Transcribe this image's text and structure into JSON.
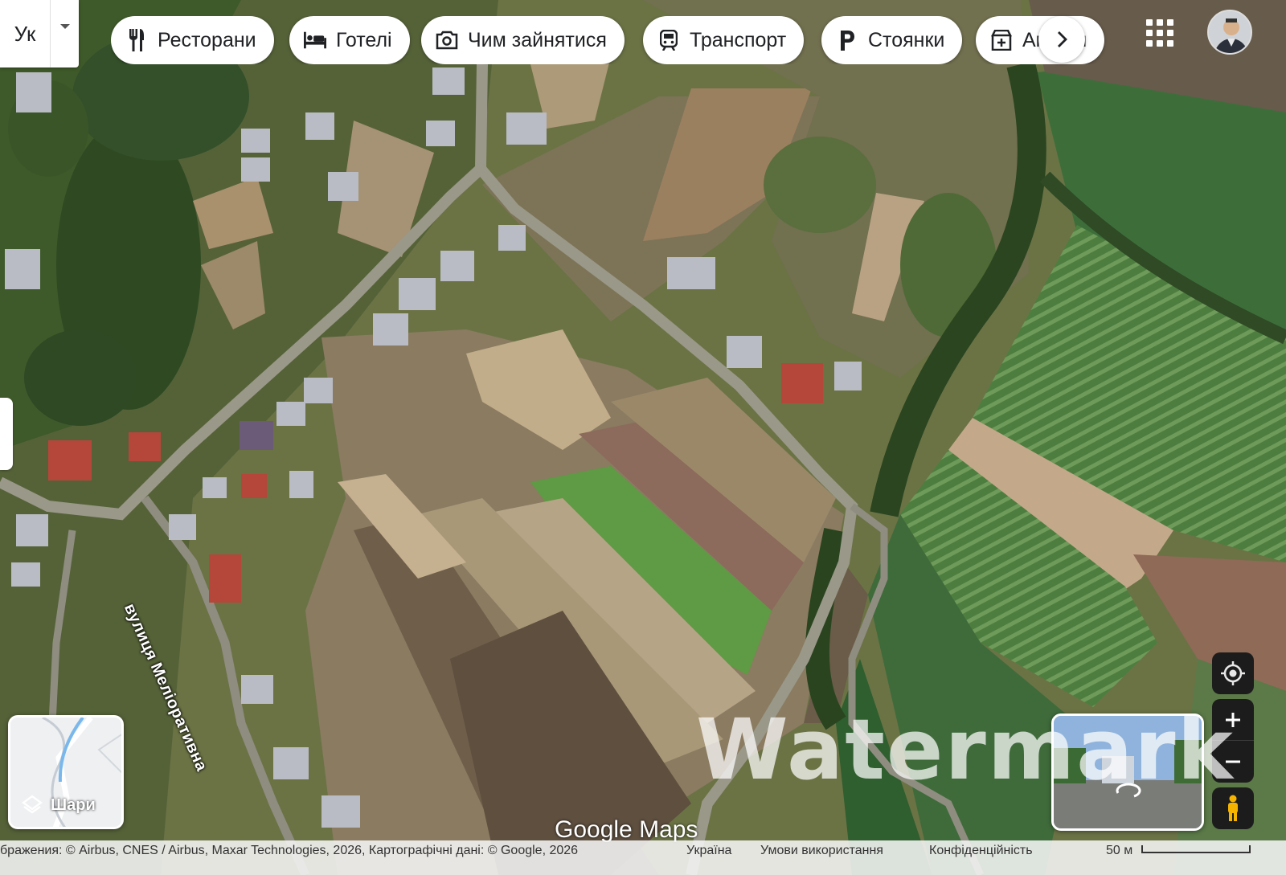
{
  "search": {
    "lang_text": "Ук"
  },
  "chips": [
    {
      "label": "Ресторани",
      "icon": "restaurant-icon"
    },
    {
      "label": "Готелі",
      "icon": "hotel-icon"
    },
    {
      "label": "Чим зайнятися",
      "icon": "camera-icon"
    },
    {
      "label": "Транспорт",
      "icon": "transit-icon"
    },
    {
      "label": "Стоянки",
      "icon": "parking-icon"
    },
    {
      "label": "Аптеки",
      "icon": "pharmacy-icon"
    }
  ],
  "map": {
    "street_label": "вулиця Меліоративна",
    "watermark": "Watermark",
    "logo": "Google Maps"
  },
  "layers": {
    "label": "Шари"
  },
  "footer": {
    "attribution": "бражения: © Airbus, CNES / Airbus, Maxar Technologies, 2026, Картографічні дані: © Google, 2026",
    "country": "Україна",
    "terms": "Умови використання",
    "privacy": "Конфіденційність",
    "scale": "50 м"
  },
  "colors": {
    "chip_bg": "#ffffff",
    "control_bg": "#1c1c1c",
    "pegman": "#f6b400"
  }
}
